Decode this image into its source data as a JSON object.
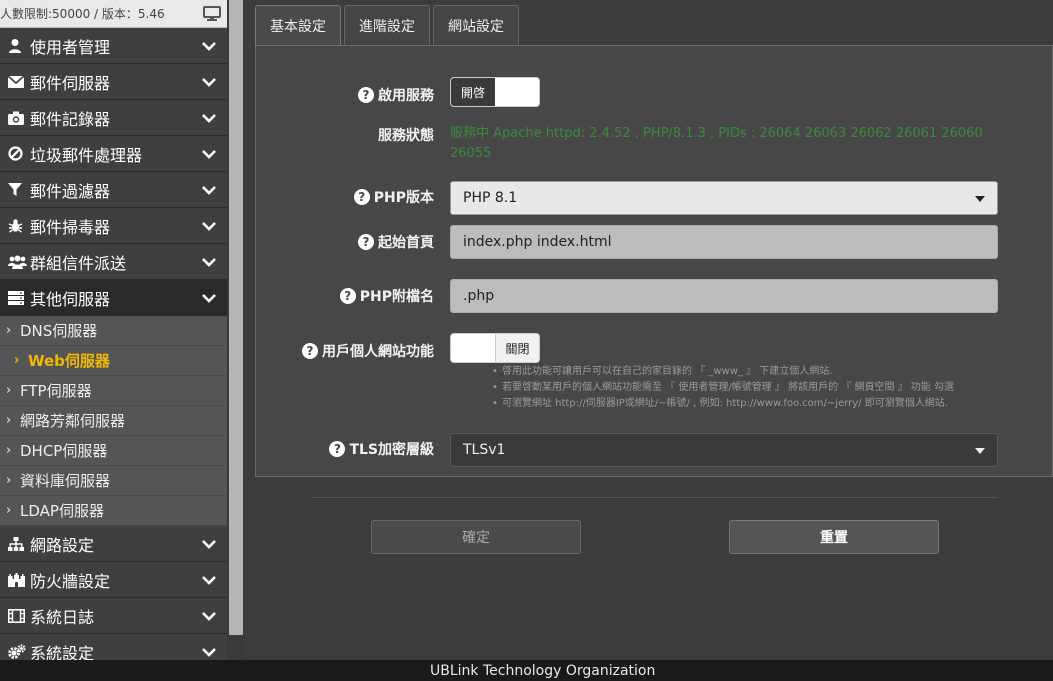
{
  "sidebar": {
    "version_text": "人數限制:50000 / 版本：5.46",
    "menu": [
      {
        "label": "使用者管理",
        "icon": "user-icon"
      },
      {
        "label": "郵件伺服器",
        "icon": "envelope-icon"
      },
      {
        "label": "郵件記錄器",
        "icon": "camera-icon"
      },
      {
        "label": "垃圾郵件處理器",
        "icon": "ban-icon"
      },
      {
        "label": "郵件過濾器",
        "icon": "filter-icon"
      },
      {
        "label": "郵件掃毒器",
        "icon": "bug-icon"
      },
      {
        "label": "群組信件派送",
        "icon": "users-icon"
      },
      {
        "label": "其他伺服器",
        "icon": "server-icon"
      }
    ],
    "submenu": [
      {
        "label": "DNS伺服器"
      },
      {
        "label": "Web伺服器"
      },
      {
        "label": "FTP伺服器"
      },
      {
        "label": "網路芳鄰伺服器"
      },
      {
        "label": "DHCP伺服器"
      },
      {
        "label": "資料庫伺服器"
      },
      {
        "label": "LDAP伺服器"
      }
    ],
    "menu_bottom": [
      {
        "label": "網路設定",
        "icon": "sitemap-icon"
      },
      {
        "label": "防火牆設定",
        "icon": "castle-icon"
      },
      {
        "label": "系統日誌",
        "icon": "film-icon"
      },
      {
        "label": "系統設定",
        "icon": "gears-icon"
      }
    ]
  },
  "tabs": [
    {
      "label": "基本設定"
    },
    {
      "label": "進階設定"
    },
    {
      "label": "網站設定"
    }
  ],
  "form": {
    "enable_service": {
      "label": "啟用服務",
      "toggle_text": "開啓"
    },
    "service_status": {
      "label": "服務狀態",
      "value": "服務中 Apache httpd: 2.4.52 , PHP/8.1.3 , PIDs : 26064 26063 26062 26061 26060 26055"
    },
    "php_version": {
      "label": "PHP版本",
      "value": "PHP 8.1"
    },
    "index_page": {
      "label": "起始首頁",
      "value": "index.php index.html"
    },
    "php_ext": {
      "label": "PHP附檔名",
      "value": ".php"
    },
    "user_site": {
      "label": "用戶個人網站功能",
      "toggle_text": "關閉"
    },
    "hints": [
      "啓用此功能可讓用戶可以在自己的家目錄的 『 _www_ 』 下建立個人網站.",
      "若要啓動某用戶的個人網站功能需至 『 使用者管理/帳號管理 』 將該用戶的 『 網頁空間 』 功能 勾選",
      "可瀏覽網址 http://伺服器IP或網址/~帳號/ , 例如: http://www.foo.com/~jerry/ 即可瀏覽個人網站."
    ],
    "tls_level": {
      "label": "TLS加密層級",
      "value": "TLSv1"
    }
  },
  "buttons": {
    "confirm": "確定",
    "reset": "重置"
  },
  "footer": {
    "text": "UBLink Technology Organization"
  },
  "colors": {
    "accent": "#f0b800",
    "status_green": "#3b8a3b"
  }
}
